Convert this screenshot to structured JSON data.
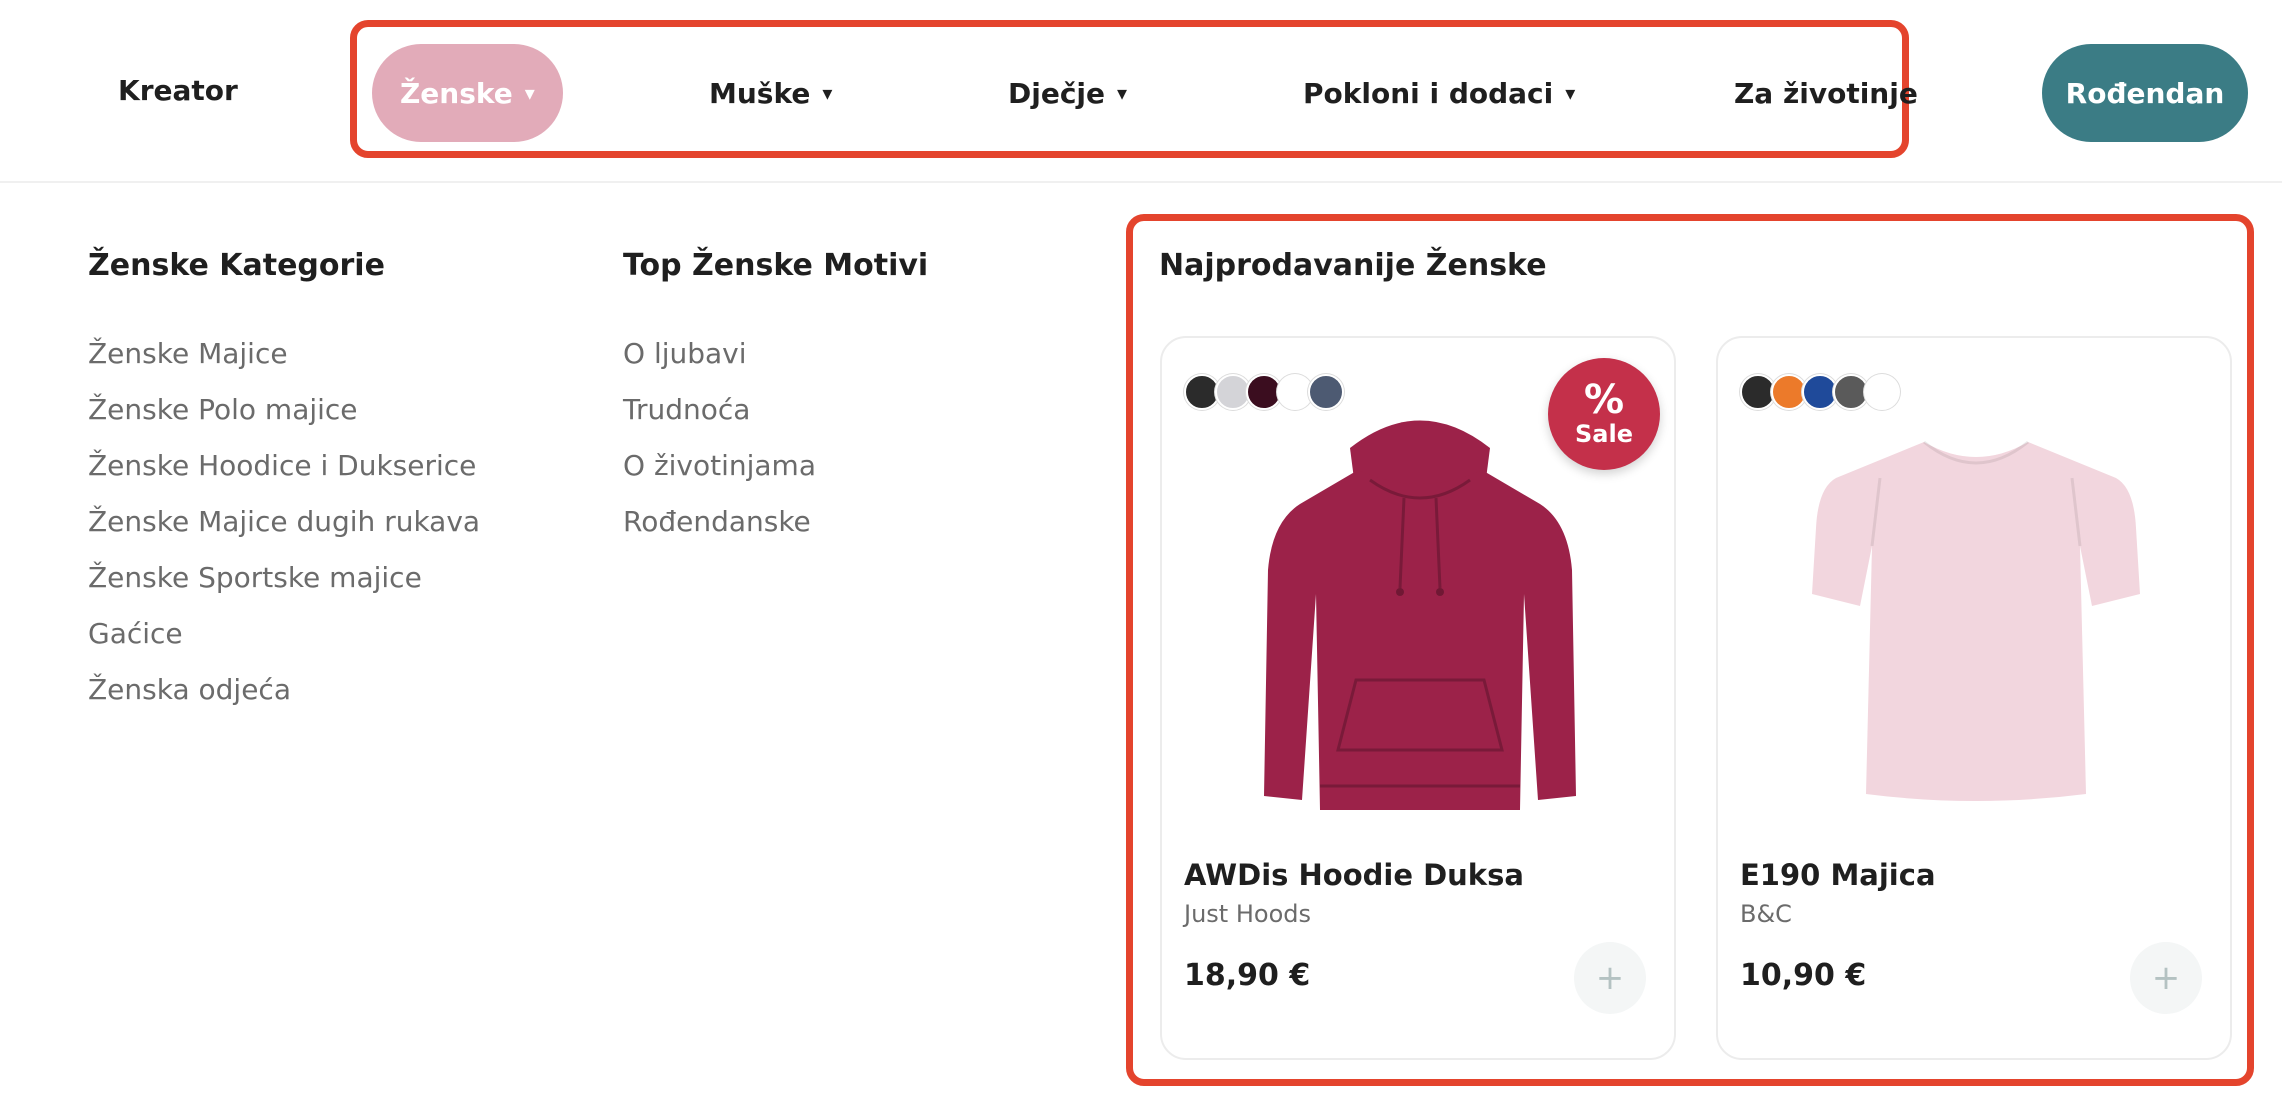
{
  "nav": {
    "kreator": "Kreator",
    "items": [
      {
        "label": "Ženske",
        "caret": "▾",
        "active": true
      },
      {
        "label": "Muške",
        "caret": "▾"
      },
      {
        "label": "Dječje",
        "caret": "▾"
      },
      {
        "label": "Pokloni i dodaci",
        "caret": "▾"
      },
      {
        "label": "Za životinje"
      }
    ],
    "birthday_button": "Rođendan",
    "colors": {
      "active_pill": "#e2abb9",
      "birthday_button": "#3b7c85",
      "highlight_border": "#e4442d"
    }
  },
  "menu": {
    "categories": {
      "title": "Ženske Kategorie",
      "links": [
        "Ženske Majice",
        "Ženske Polo majice",
        "Ženske Hoodice i Dukserice",
        "Ženske Majice dugih rukava",
        "Ženske Sportske majice",
        "Gaćice",
        "Ženska odjeća"
      ]
    },
    "motifs": {
      "title": "Top Ženske Motivi",
      "links": [
        "O ljubavi",
        "Trudnoća",
        "O životinjama",
        "Rođendanske"
      ]
    }
  },
  "bestsellers": {
    "title": "Najprodavanije Ženske",
    "products": [
      {
        "name": "AWDis Hoodie Duksa",
        "brand": "Just Hoods",
        "price": "18,90 €",
        "sale_badge": {
          "symbol": "%",
          "text": "Sale",
          "color": "#c4304a"
        },
        "swatches": [
          "#2b2b2b",
          "#d4d4d8",
          "#3b0d1f",
          "#ffffff",
          "#4d5a72"
        ],
        "image_icon": "hoodie-icon",
        "image_color": "#9c2249",
        "add_symbol": "+"
      },
      {
        "name": "E190 Majica",
        "brand": "B&C",
        "price": "10,90 €",
        "swatches": [
          "#2b2b2b",
          "#ec7a2a",
          "#1f4a9a",
          "#5a5a5a",
          "#ffffff"
        ],
        "image_icon": "tshirt-icon",
        "image_color": "#f2d6de",
        "add_symbol": "+"
      }
    ]
  }
}
